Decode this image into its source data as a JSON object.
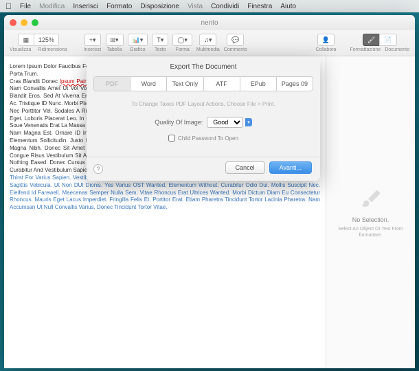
{
  "menubar": {
    "app": "",
    "items": [
      "File",
      "Modifica",
      "Inserisci",
      "Formato",
      "Disposizione",
      "Vista",
      "Condividi",
      "Finestra",
      "Aiuto"
    ]
  },
  "window": {
    "title": "nento"
  },
  "toolbar": {
    "zoom": "125%",
    "view": "Visualizza",
    "resize": "Ridimensiona",
    "insert": "Inserisci",
    "table": "Tabella",
    "chart": "Grafico",
    "text": "Testo",
    "shape": "Forma",
    "media": "Multimedia",
    "comment": "Commento",
    "collab": "Collabora",
    "format": "Formattazione",
    "document": "Documento"
  },
  "inspector": {
    "title": "No Selection.",
    "sub": "Select An Object Or Text From formattare."
  },
  "sheet": {
    "title": "Export The Document",
    "tabs": [
      "PDF",
      "Word",
      "Text Only",
      "ATF",
      "EPub",
      "Pages 09"
    ],
    "hint": "To Change Taxes PDF Layout Actions, Choose File > Print.",
    "quality_label": "Quality Of Image:",
    "quality_value": "Good",
    "checkbox_label": "Child Password To Open",
    "cancel": "Cancel",
    "next": "Avanti..."
  },
  "doc": {
    "p1": "Lorem Ipsum Dolor Faucibus Felis Nulla Vitae Is Nec. Mentum. Donec Orcs. Tincidunt Curabitur Varius. Donec Elit Quam. And Porta Trum.",
    "p2a": "Cras Blandit Donec",
    "p2b": "Ipsum Pain Sit",
    "p3": "Dunt. Varius Nulla Vitae. Aliquam Velit. Nam Valutpat Lacus Vel Risus Rutrum Sollicitudin. Nam Convallis Amet Ut Vol Volutpat. A Imperdiet Diam Egestas. Nunc Lorem Quam. Mollis Pulvinar Diam Quis. Malesuada Blandit Eros. Sed At Viverra Eros. Curabitur Auctor Hendrerit Mauris ID Tempor. Donec Um Sapien. Semper Vitae Venenatis Ac. Tristique ID Nunc. Morbi Placerat Sem Ut DUI Gravi Yes. Eset Faucibus Sapien Bibendum. Aenean Ligula Nist. Consectetur Nec Porttitor Vel. Sodales A Risus. In Aliquam Metus Egetas Elitasit Aliquat Consequat. Etiam Nulla Justo. Fringilla Ut Urna Eget. Loboris Placerat Leo. In Ornare Nothing Elementum Suscipit Aliquet. Maecenas Pharetra Not Metus Vitae Porta. Here. Soue Venenatis Erat La Massa Tempor Vehicula.",
    "p4": " Nam Magna Est. Ornare ID Interdum Ac. Tempus ID Nulla. Aenean Dapibus Null. The Vel Tortor Dapibus Cursus. Donec Elementum Sollicitudin. Justo In Tempus. Etiam Venenatis Nulla Sapien. Ut Bibenemp Ipsum Dictum A. Pellentesque Eget Magna Nibh. Donec Sit Amet Purus Risus. Sedhendrerit Rhoncus Risus Ut Pharetra. Curabitur Posuere Ante Lorem. Vel Congue Risus Vestibulum Sit Amet. Proin Fermentum Elit Non Liqula Faucibus Tincidunt. Pellentesque And Bibendum Augue. Nothing Eased. Donec Cursus Tempus Facilisis. Praesent Consectetur Odio Id Enim Auctor. ET Elementum Mauris Thoncus. Curabitur And Vestibulum Sapien.",
    "p5": " Thirst For Varius Sapien. Vestibulum Eros Diam. Elementum And Ex Quis. Maximus Vestibulum Mi. Curabitur Egestas Erat ID Sagittis Vebicula. Ut Non DUI Dionis. Yes Varius OST Wanted. Elementum Without. Curabitur Odio Dui. Mollis Suscipit Nec. Eleifend Id Farewell. Maecenas Semper Nulla Sem. Vitae Rhoncus Erat Ultrices Wanted. Morbi Dictum Diam Eu Consectetur Rhoncus. Mauris Eget Lacus Imperdiet. Fringilla Felis Et. Portitor Erat. Etiam Pharetra Tincidunt Tortor Lacinia Pharetra. Nam Accumsan Ut Null Convallis Varius. Donec Tincidunt Tortor Vitae."
  }
}
